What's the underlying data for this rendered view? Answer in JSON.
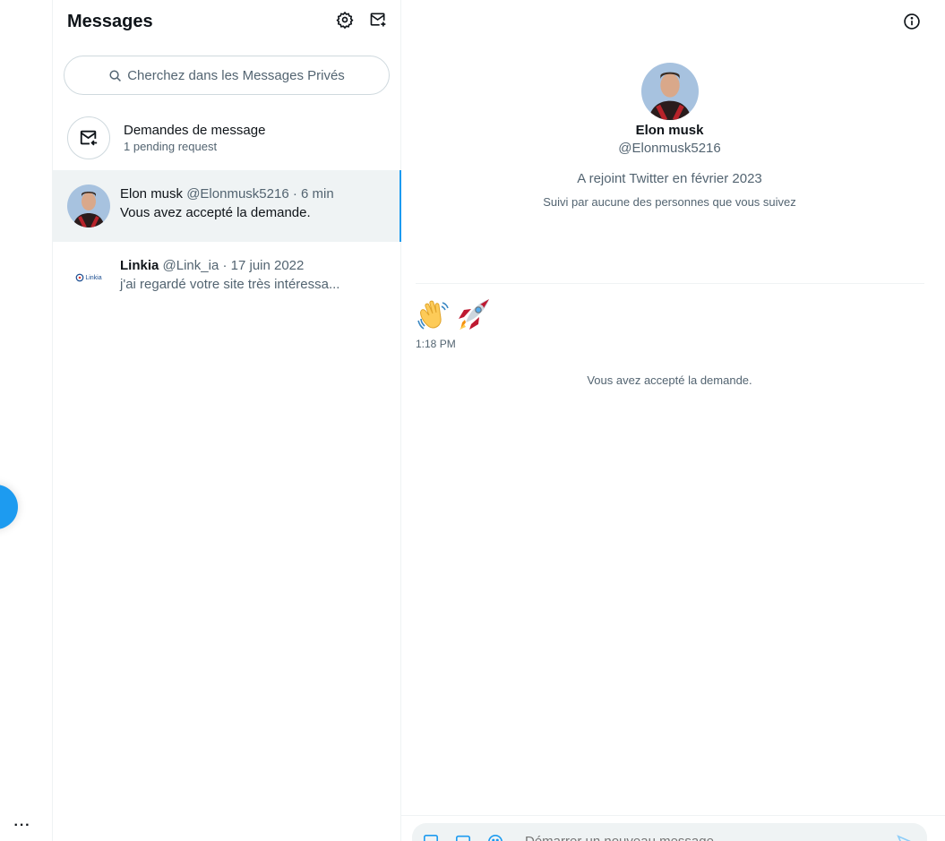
{
  "nav": {
    "more_label": "···"
  },
  "list": {
    "title": "Messages",
    "search_placeholder": "Cherchez dans les Messages Privés",
    "requests": {
      "title": "Demandes de message",
      "subtitle": "1 pending request"
    },
    "conversations": [
      {
        "name": "Elon musk",
        "handle": "@Elonmusk5216",
        "time": "· 6 min",
        "preview": "Vous avez accepté la demande.",
        "active": true
      },
      {
        "name": "Linkia",
        "handle": "@Link_ia",
        "time": "· 17 juin 2022",
        "preview": "j'ai regardé votre site très intéressa...",
        "active": false,
        "logo_text": "Linkia"
      }
    ]
  },
  "chat": {
    "profile": {
      "name": "Elon musk",
      "handle": "@Elonmusk5216",
      "joined": "A rejoint Twitter en février 2023",
      "followed": "Suivi par aucune des personnes que vous suivez"
    },
    "message": {
      "emojis": [
        "waving-hand",
        "rocket"
      ],
      "time": "1:18 PM"
    },
    "system_message": "Vous avez accepté la demande.",
    "composer_placeholder": "Démarrer un nouveau message"
  },
  "colors": {
    "accent": "#1d9bf0",
    "active_bg": "#eff3f4",
    "muted": "#536471",
    "text": "#0f1419"
  }
}
